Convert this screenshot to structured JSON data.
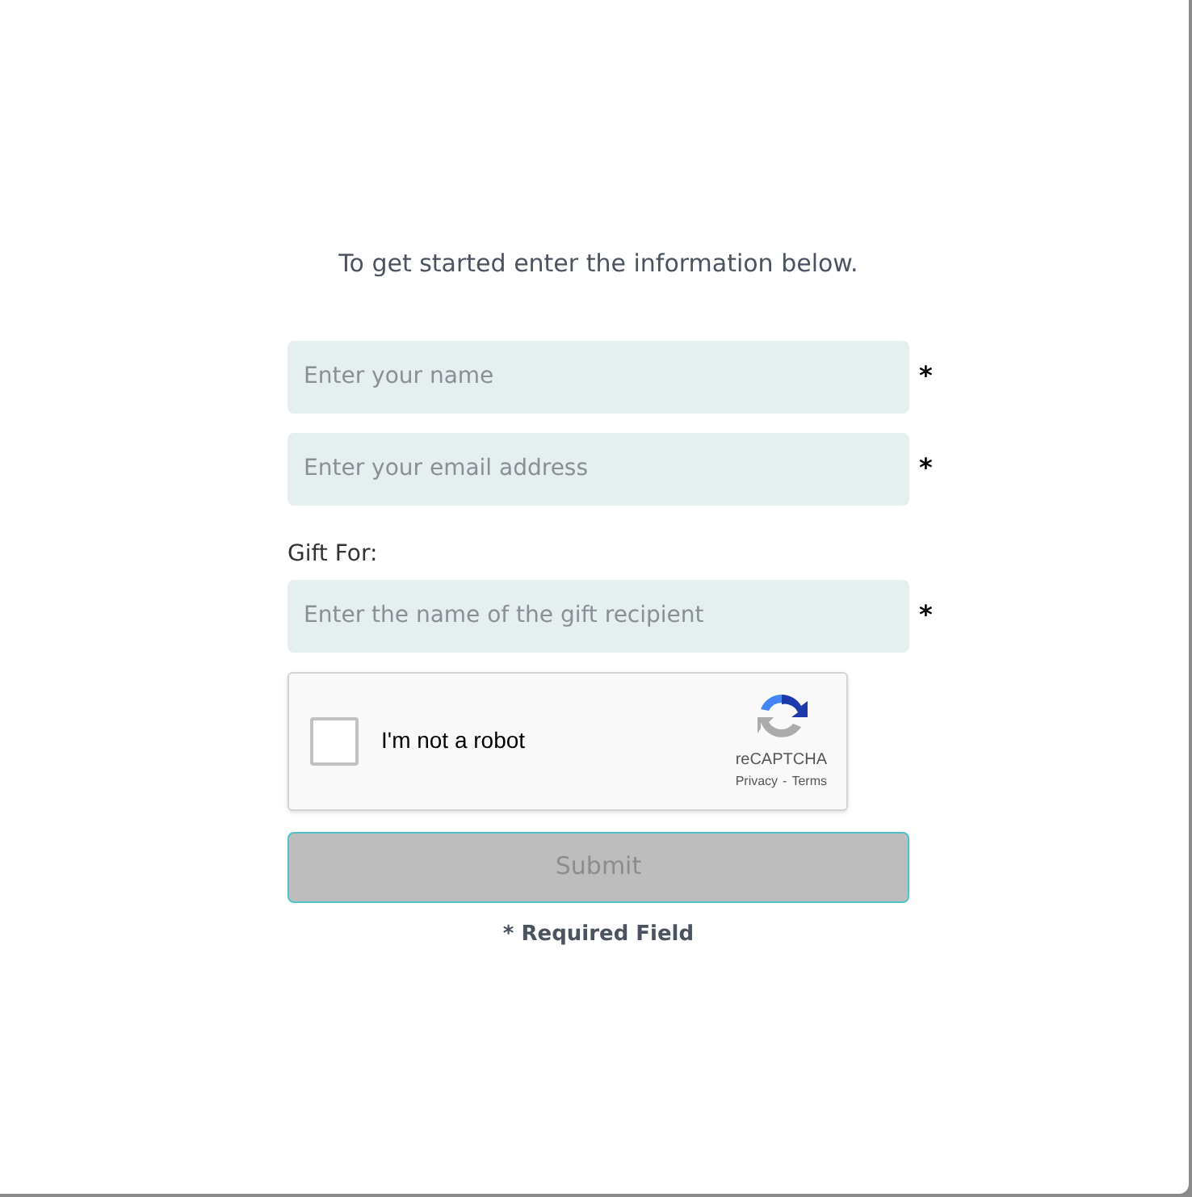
{
  "intro": "To get started enter the information below.",
  "fields": [
    {
      "placeholder": "Enter your name",
      "required_mark": "*"
    },
    {
      "placeholder": "Enter your email address",
      "required_mark": "*"
    },
    {
      "label": "Gift For:",
      "placeholder": "Enter the name of the gift recipient",
      "required_mark": "*"
    }
  ],
  "captcha": {
    "label": "I'm not a robot",
    "checked": false,
    "brand": "reCAPTCHA",
    "privacy": "Privacy",
    "separator": "-",
    "terms": "Terms"
  },
  "submit": {
    "label": "Submit",
    "disabled": true
  },
  "footnote": "* Required Field"
}
